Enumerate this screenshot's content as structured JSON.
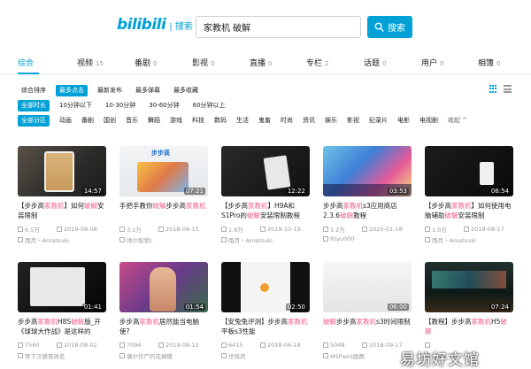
{
  "logo": {
    "brand": "bilibili",
    "sub": "| 搜索"
  },
  "search": {
    "value": "家教机 破解",
    "button_label": "搜索"
  },
  "tabs": [
    {
      "label": "综合",
      "count": ""
    },
    {
      "label": "视频",
      "count": "15"
    },
    {
      "label": "番剧",
      "count": "0"
    },
    {
      "label": "影视",
      "count": "0"
    },
    {
      "label": "直播",
      "count": "0"
    },
    {
      "label": "专栏",
      "count": "2"
    },
    {
      "label": "话题",
      "count": "0"
    },
    {
      "label": "用户",
      "count": "0"
    },
    {
      "label": "相簿",
      "count": "0"
    }
  ],
  "sort": [
    "综合排序",
    "最多点击",
    "最新发布",
    "最多弹幕",
    "最多收藏"
  ],
  "duration": [
    "全部时长",
    "10分钟以下",
    "10-30分钟",
    "30-60分钟",
    "60分钟以上"
  ],
  "zones": [
    "全部分区",
    "动画",
    "番剧",
    "国创",
    "音乐",
    "舞蹈",
    "游戏",
    "科技",
    "数码",
    "生活",
    "鬼畜",
    "时尚",
    "资讯",
    "娱乐",
    "影视",
    "纪录片",
    "电影",
    "电视剧",
    "收起 ^"
  ],
  "videos": [
    {
      "duration": "14:57",
      "title_pre": "【步步高",
      "hl1": "家教机",
      "title_mid": "】如何",
      "hl2": "破解",
      "title_post": "安装限制",
      "plays": "6.5万",
      "date": "2019-08-08",
      "uploader": "雨月丶Amatsuki"
    },
    {
      "duration": "07:21",
      "title_pre": "手把手教你",
      "hl1": "破解",
      "title_mid": "步步高",
      "hl2": "家教机",
      "title_post": "",
      "plays": "3.1万",
      "date": "2018-06-15",
      "uploader": "帅の智爱L"
    },
    {
      "duration": "12:22",
      "title_pre": "【步步高",
      "hl1": "家教机",
      "title_mid": "】H9A和S1Pro的",
      "hl2": "破解",
      "title_post": "安装限制教程",
      "plays": "1.8万",
      "date": "2019-10-19",
      "uploader": "雨月丶Amatsuki"
    },
    {
      "duration": "03:53",
      "title_pre": "步步高",
      "hl1": "家教机",
      "title_mid": "s3应用商店2.3.6",
      "hl2": "破解",
      "title_post": "教程",
      "plays": "1.2万",
      "date": "2020-01-18",
      "uploader": "Rtyu000"
    },
    {
      "duration": "06:54",
      "title_pre": "【步步高",
      "hl1": "家教机",
      "title_mid": "】如何使用电脑辅助",
      "hl2": "破解",
      "title_post": "安装限制",
      "plays": "1.0万",
      "date": "2019-08-17",
      "uploader": "雨月丶Amatsuki"
    },
    {
      "duration": "01:41",
      "title_pre": "步步高",
      "hl1": "家教机",
      "title_mid": "H8S",
      "hl2": "破解",
      "title_post": "版_开《球球大作战》是这样的",
      "plays": "7560",
      "date": "2018-08-02",
      "uploader": "等下次感冒改名"
    },
    {
      "duration": "01:54",
      "title_pre": "步步高",
      "hl1": "家教机",
      "title_mid": "居然能当电脑使?",
      "hl2": "",
      "title_post": "",
      "plays": "7094",
      "date": "2019-08-12",
      "uploader": "偶尔作尸的花蝴蝶"
    },
    {
      "duration": "02:50",
      "title_pre": "【安兔兔评测】步步高",
      "hl1": "家教机",
      "title_mid": "平板s3性能",
      "hl2": "",
      "title_post": "",
      "plays": "6415",
      "date": "2018-06-18",
      "uploader": "世琦月"
    },
    {
      "duration": "06:00",
      "title_pre": "",
      "hl1": "破解",
      "title_mid": "步步高",
      "hl2": "家教机",
      "title_post": "s3时间限制",
      "plays": "5048",
      "date": "2018-09-17",
      "uploader": "MSPaint画图"
    },
    {
      "duration": "07:24",
      "title_pre": "【教程】步步高",
      "hl1": "家教机",
      "title_mid": "H5",
      "hl2": "破解",
      "title_post": "",
      "plays": "",
      "date": "",
      "uploader": "Stars_嗯"
    }
  ],
  "watermark": "易坊好文馆"
}
